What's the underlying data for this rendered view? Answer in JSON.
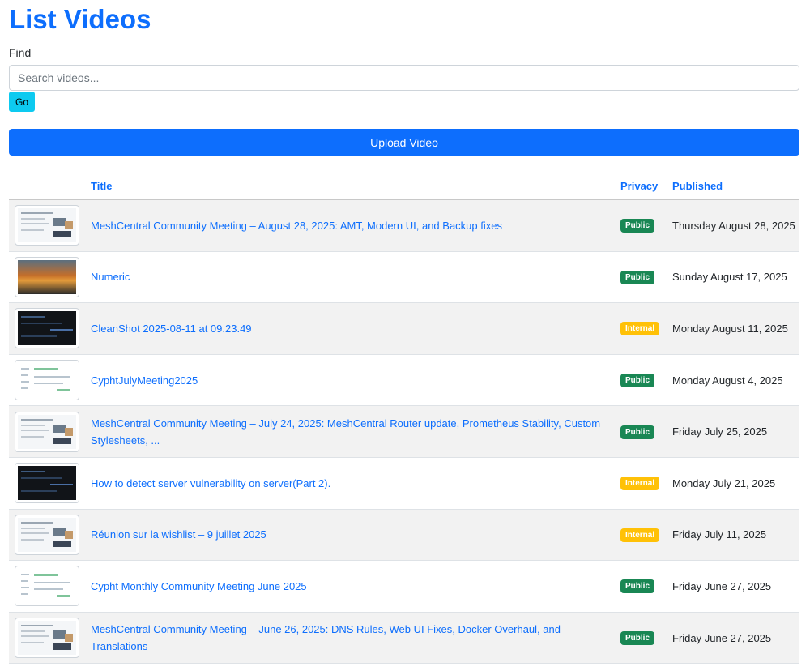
{
  "page": {
    "title": "List Videos",
    "find_label": "Find",
    "search_placeholder": "Search videos...",
    "go_label": "Go",
    "upload_label": "Upload Video"
  },
  "table": {
    "headers": {
      "title": "Title",
      "privacy": "Privacy",
      "published": "Published"
    },
    "rows": [
      {
        "title": "MeshCentral Community Meeting – August 28, 2025: AMT, Modern UI, and Backup fixes",
        "privacy": "Public",
        "published": "Thursday August 28, 2025",
        "thumb": "doc"
      },
      {
        "title": "Numeric",
        "privacy": "Public",
        "published": "Sunday August 17, 2025",
        "thumb": "sunset"
      },
      {
        "title": "CleanShot 2025-08-11 at 09.23.49",
        "privacy": "Internal",
        "published": "Monday August 11, 2025",
        "thumb": "dark"
      },
      {
        "title": "CyphtJulyMeeting2025",
        "privacy": "Public",
        "published": "Monday August 4, 2025",
        "thumb": "form"
      },
      {
        "title": "MeshCentral Community Meeting – July 24, 2025: MeshCentral Router update, Prometheus Stability, Custom Stylesheets, ...",
        "privacy": "Public",
        "published": "Friday July 25, 2025",
        "thumb": "doc"
      },
      {
        "title": "How to detect server vulnerability on server(Part 2).",
        "privacy": "Internal",
        "published": "Monday July 21, 2025",
        "thumb": "dark"
      },
      {
        "title": "Réunion sur la wishlist – 9 juillet 2025",
        "privacy": "Internal",
        "published": "Friday July 11, 2025",
        "thumb": "doc"
      },
      {
        "title": "Cypht Monthly Community Meeting June 2025",
        "privacy": "Public",
        "published": "Friday June 27, 2025",
        "thumb": "form"
      },
      {
        "title": "MeshCentral Community Meeting – June 26, 2025: DNS Rules, Web UI Fixes, Docker Overhaul, and Translations",
        "privacy": "Public",
        "published": "Friday June 27, 2025",
        "thumb": "doc"
      }
    ]
  },
  "colors": {
    "primary": "#0d6efd",
    "info": "#0dcaf0",
    "public_badge": "#198754",
    "internal_badge": "#ffc107"
  }
}
